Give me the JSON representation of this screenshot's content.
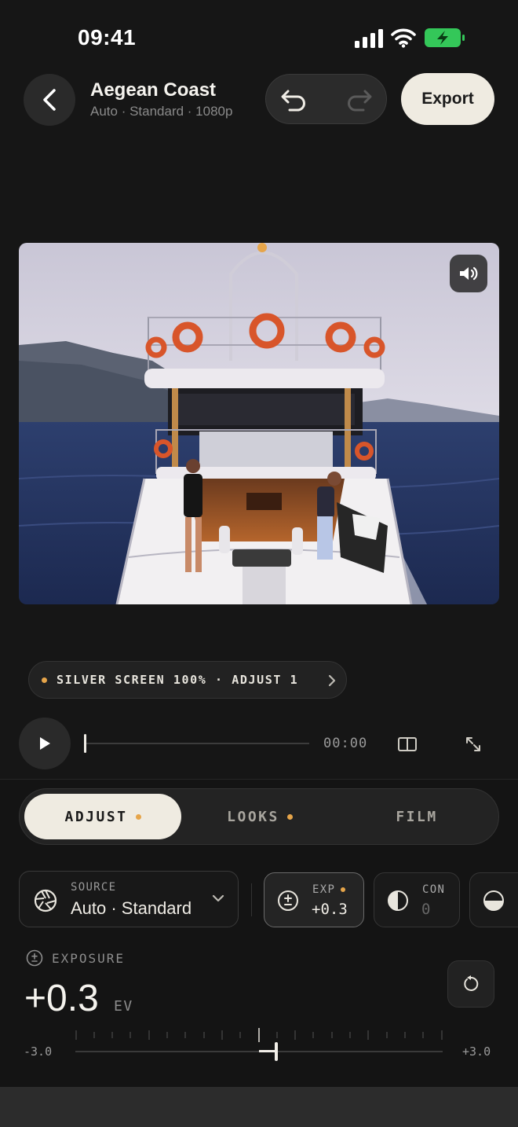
{
  "status_bar": {
    "time": "09:41"
  },
  "header": {
    "title": "Aegean Coast",
    "subtitle": "Auto · Standard · 1080p",
    "export_label": "Export"
  },
  "filter_chip": {
    "text": "SILVER SCREEN 100% · ADJUST 1"
  },
  "playback": {
    "timecode": "00:00",
    "progress": 0
  },
  "tabs": [
    {
      "label": "ADJUST",
      "active": true,
      "dot": true
    },
    {
      "label": "LOOKS",
      "active": false,
      "dot": true
    },
    {
      "label": "FILM",
      "active": false,
      "dot": false
    }
  ],
  "source": {
    "label": "SOURCE",
    "value": "Auto · Standard"
  },
  "params": [
    {
      "label": "EXP",
      "value": "+0.3",
      "active": true,
      "dot": true
    },
    {
      "label": "CON",
      "value": "0",
      "active": false,
      "dot": false
    }
  ],
  "exposure": {
    "label": "EXPOSURE",
    "value": "+0.3",
    "unit": "EV",
    "min_label": "-3.0",
    "max_label": "+3.0",
    "min": -3.0,
    "max": 3.0,
    "current": 0.3
  },
  "colors": {
    "accent_dot": "#e6a54a",
    "primary_button": "#efebe1",
    "battery": "#34c759"
  },
  "icons": [
    "back-arrow-icon",
    "undo-icon",
    "redo-icon",
    "speaker-icon",
    "play-icon",
    "split-compare-icon",
    "expand-icon",
    "aperture-icon",
    "chevron-down-icon",
    "exposure-icon",
    "contrast-icon",
    "half-circle-icon",
    "reset-icon"
  ]
}
